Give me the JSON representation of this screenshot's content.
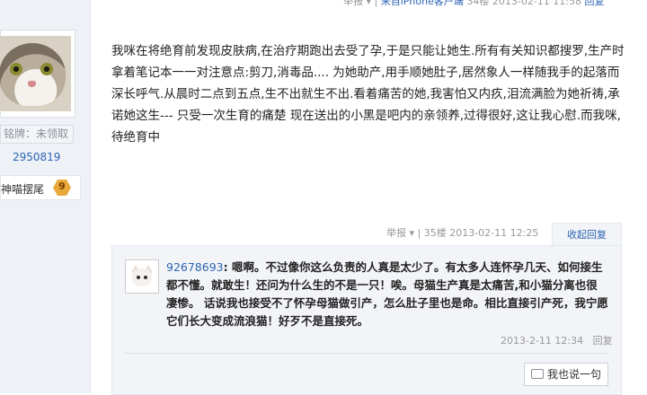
{
  "left": {
    "medal_text": "铭牌：未领取",
    "user_id": "2950819",
    "user_title": "神喵摆尾",
    "level": "9"
  },
  "top_meta": {
    "report": "举报",
    "source": "来自iPhone客户端",
    "floor": "34楼",
    "time": "2013-02-11 11:58",
    "reply": "回复"
  },
  "post": {
    "text": "我咪在将绝育前发现皮肤病,在治疗期跑出去受了孕,于是只能让她生.所有有关知识都搜罗,生产时拿着笔记本一一对注意点:剪刀,消毒品.... 为她助产,用手顺她肚子,居然象人一样随我手的起落而深长呼气.从晨时二点到五点,生不出就生不出.看着痛苦的她,我害怕又内疚,泪流满脸为她祈祷,承诺她这生--- 只受一次生育的痛楚 现在送出的小黑是吧内的亲领养,过得很好,这让我心慰.而我咪,待绝育中"
  },
  "floor_bar": {
    "report": "举报",
    "floor": "35楼",
    "time": "2013-02-11 12:25",
    "collapse_label": "收起回复"
  },
  "reply": {
    "username": "92678693",
    "text": "嗯啊。不过像你这么负责的人真是太少了。有太多人连怀孕几天、如何接生都不懂。就敢生！还问为什么生的不是一只！唉。母猫生产真是太痛苦,和小猫分离也很凄惨。 话说我也接受不了怀孕母猫做引产，怎么肚子里也是命。相比直接引产死，我宁愿它们长大变成流浪猫！好歹不是直接死。",
    "time": "2013-2-11 12:34",
    "reply_label": "回复"
  },
  "say_button": "我也说一句"
}
